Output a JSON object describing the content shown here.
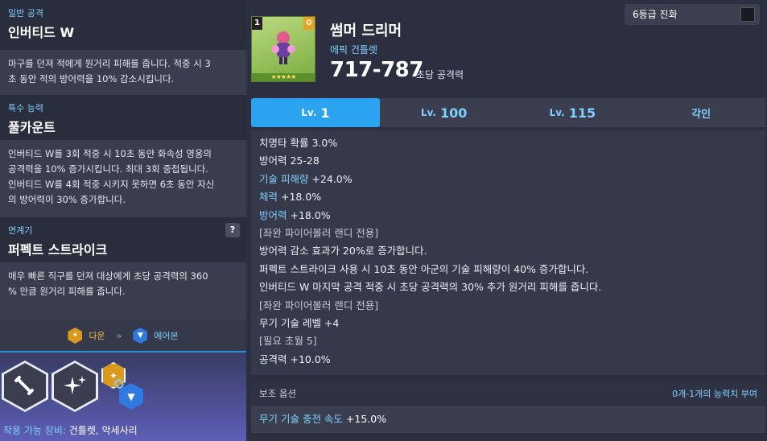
{
  "skills": [
    {
      "tag": "일반 공격",
      "title": "인버티드 W",
      "desc": [
        "마구를 던져 적에게 원거리 피해를 줍니다. 적중 시 3",
        "초 동안 적의 방어력을 10% 감소시킵니다."
      ]
    },
    {
      "tag": "특수 능력",
      "title": "풀카운트",
      "desc": [
        "인버티드 W를 3회 적중 시 10초 동안 화속성 영웅의",
        "공격력을 10% 증가시킵니다. 최대 3회 중첩됩니다.",
        "인버티드 W를 4회 적중 시키지 못하면 6초 동안 자신",
        "의 방어력이 30% 증가합니다."
      ]
    },
    {
      "tag": "연계기",
      "title": "퍼펙트 스트라이크",
      "desc": [
        "매우 빠른 직구를 던져 대상에게 초당 공격력의 360",
        "% 만큼 원거리 피해를 줍니다."
      ]
    }
  ],
  "help_label": "?",
  "chain": {
    "from": "다운",
    "arrow": "»",
    "to": "에어본"
  },
  "equip": {
    "label": "착용 가능 장비:",
    "value": " 건틀렛, 악세사리"
  },
  "weapon": {
    "level_badge": "1",
    "stars": "★★★★★",
    "name": "썸머 드리머",
    "grade": "에픽 건틀렛",
    "attack": "717-787",
    "attack_label": "초당 공격력"
  },
  "evolution": {
    "label": "6등급 진화"
  },
  "tabs": [
    {
      "lv": "Lv.",
      "num": "1",
      "active": true
    },
    {
      "lv": "Lv.",
      "num": "100",
      "active": false
    },
    {
      "lv": "Lv.",
      "num": "115",
      "active": false
    },
    {
      "lv": "",
      "num": "각인",
      "active": false
    }
  ],
  "stats": [
    {
      "k": "",
      "v": "치명타 확률  3.0%"
    },
    {
      "k": "",
      "v": "방어력  25-28"
    },
    {
      "k": "기술 피해량",
      "v": "  +24.0%"
    },
    {
      "k": "체력",
      "v": "  +18.0%"
    },
    {
      "k": "방어력",
      "v": "  +18.0%"
    },
    {
      "k": "",
      "v": "[좌완 파이어볼러 랜디 전용]",
      "gray": true
    },
    {
      "k": "",
      "v": "방어력 감소 효과가 20%로 증가합니다."
    },
    {
      "k": "",
      "v": "퍼펙트 스트라이크 사용 시 10초 동안 아군의 기술 피해량이 40% 증가합니다."
    },
    {
      "k": "",
      "v": "인버티드 W 마지막 공격 적중 시 초당 공격력의 30% 추가 원거리 피해를 줍니다."
    },
    {
      "k": "",
      "v": "[좌완 파이어볼러 랜디 전용]",
      "gray": true
    },
    {
      "k": "",
      "v": "무기 기술 레벨 +4"
    },
    {
      "k": "",
      "v": "[필요 초월 5]",
      "gray": true
    },
    {
      "k": "",
      "v": "공격력 +10.0%"
    }
  ],
  "sub_option": {
    "title": "보조 옵션",
    "range": "0개-1개의 능력치 부여",
    "k": "무기 기술 충전 속도",
    "v": "  +15.0%"
  }
}
